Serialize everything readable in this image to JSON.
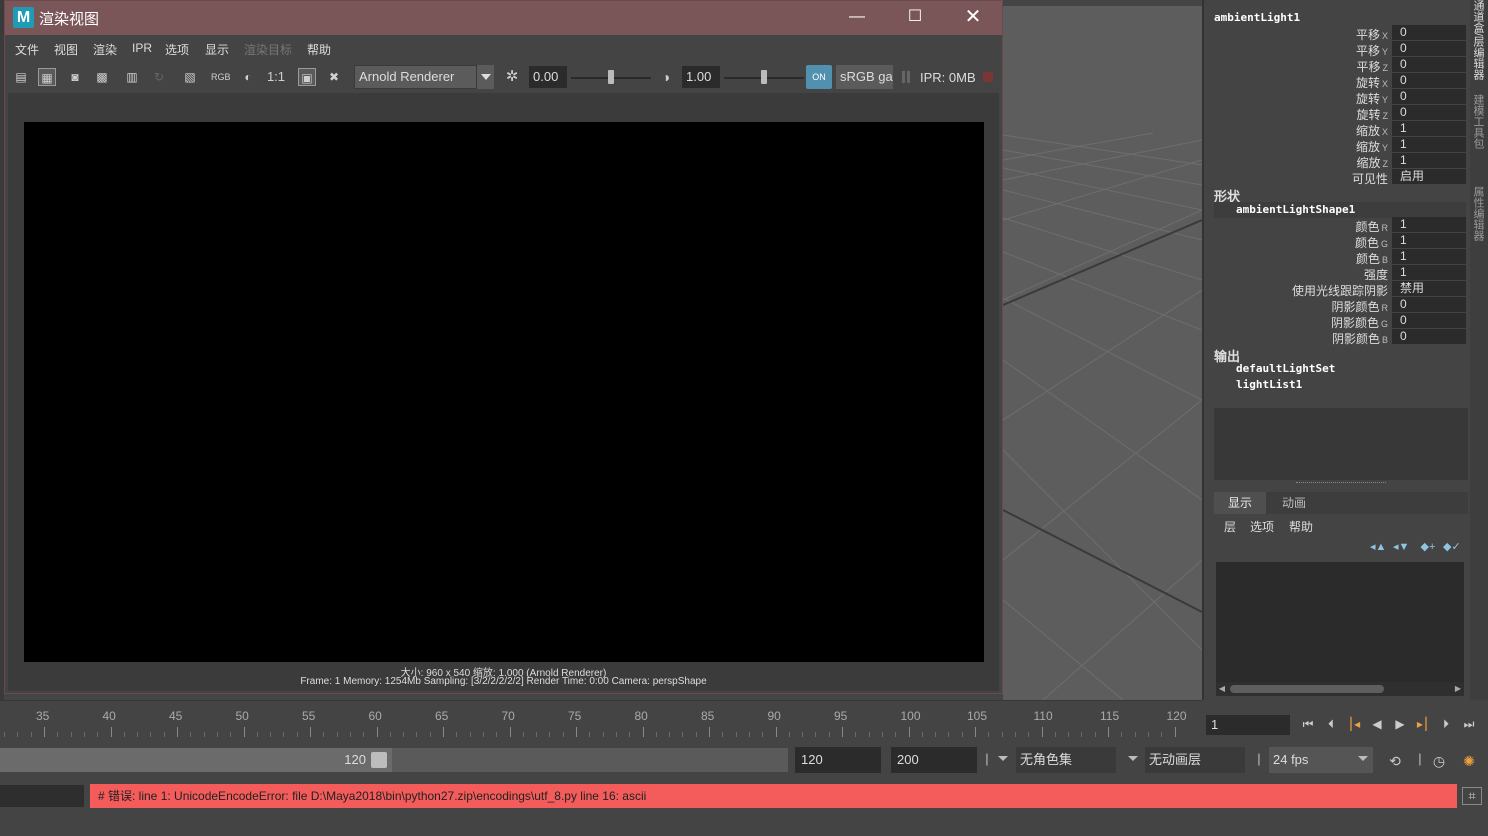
{
  "render_window": {
    "logo": "M",
    "title": "渲染视图",
    "controls": {
      "minimize": "—",
      "maximize": "☐",
      "close": "✕"
    },
    "menu": [
      "文件",
      "视图",
      "渲染",
      "IPR",
      "选项",
      "显示",
      "渲染目标",
      "帮助"
    ],
    "toolbar": {
      "rgb_label": "RGB",
      "ratio_label": "1:1",
      "renderer": "Arnold Renderer",
      "exposure": "0.00",
      "gamma": "1.00",
      "colorspace_btn": "ON",
      "colorspace": "sRGB gamma",
      "ipr_memory": "IPR: 0MB"
    },
    "info_line_1": "大小: 960 x 540  缩放: 1.000     (Arnold Renderer)",
    "info_line_2": "Frame: 1     Memory: 1254Mb     Sampling: [3/2/2/2/2/2]     Render Time: 0:00     Camera: perspShape"
  },
  "channel_box": {
    "object": "ambientLight1",
    "transform_attrs": [
      {
        "label": "平移",
        "axis": "X",
        "value": "0"
      },
      {
        "label": "平移",
        "axis": "Y",
        "value": "0"
      },
      {
        "label": "平移",
        "axis": "Z",
        "value": "0"
      },
      {
        "label": "旋转",
        "axis": "X",
        "value": "0"
      },
      {
        "label": "旋转",
        "axis": "Y",
        "value": "0"
      },
      {
        "label": "旋转",
        "axis": "Z",
        "value": "0"
      },
      {
        "label": "缩放",
        "axis": "X",
        "value": "1"
      },
      {
        "label": "缩放",
        "axis": "Y",
        "value": "1"
      },
      {
        "label": "缩放",
        "axis": "Z",
        "value": "1"
      },
      {
        "label": "可见性",
        "axis": "",
        "value": "启用"
      }
    ],
    "shapes_header": "形状",
    "shape_node": "ambientLightShape1",
    "shape_attrs": [
      {
        "label": "颜色",
        "axis": "R",
        "value": "1"
      },
      {
        "label": "颜色",
        "axis": "G",
        "value": "1"
      },
      {
        "label": "颜色",
        "axis": "B",
        "value": "1"
      },
      {
        "label": "强度",
        "axis": "",
        "value": "1"
      },
      {
        "label": "使用光线跟踪阴影",
        "axis": "",
        "value": "禁用"
      },
      {
        "label": "阴影颜色",
        "axis": "R",
        "value": "0"
      },
      {
        "label": "阴影颜色",
        "axis": "G",
        "value": "0"
      },
      {
        "label": "阴影颜色",
        "axis": "B",
        "value": "0"
      }
    ],
    "outputs_header": "输出",
    "outputs": [
      "defaultLightSet",
      "lightList1"
    ]
  },
  "layer_editor": {
    "tabs": [
      "显示",
      "动画"
    ],
    "menu": [
      "层",
      "选项",
      "帮助"
    ]
  },
  "side_tabs": [
    "通道盒/层编辑器",
    "建模工具包",
    "属性编辑器"
  ],
  "timeline": {
    "ticks": [
      "35",
      "40",
      "45",
      "50",
      "55",
      "60",
      "65",
      "70",
      "75",
      "80",
      "85",
      "90",
      "95",
      "100",
      "105",
      "110",
      "115",
      "120"
    ],
    "current_frame": "1"
  },
  "range": {
    "playback_end": "120",
    "end_field": "120",
    "anim_end_field": "200",
    "character_set": "无角色集",
    "anim_layer": "无动画层",
    "fps": "24 fps"
  },
  "command_line": {
    "error": "# 错误: line 1: UnicodeEncodeError: file D:\\Maya2018\\bin\\python27.zip\\encodings\\utf_8.py line 16: ascii"
  },
  "colors": {
    "titlebar": "#7a5659",
    "error_bg": "#f45b5b",
    "canvas": "#000000",
    "panel_bg": "#444444"
  }
}
